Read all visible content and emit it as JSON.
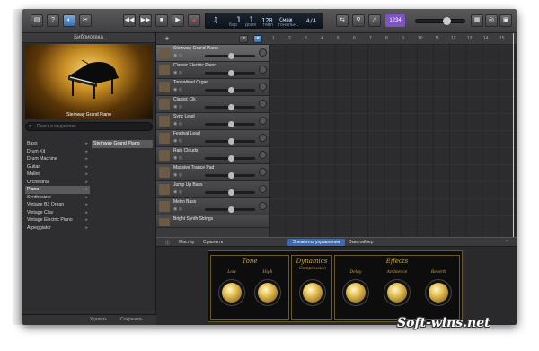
{
  "toolbar": {
    "lcd_bar": "1",
    "lcd_beat": "1",
    "lcd_bar_label": "бар",
    "lcd_beat_label": "доля",
    "tempo": "120",
    "tempo_label": "темп",
    "key": "Cмаж",
    "key_label": "тональн.",
    "time_sig": "4/4",
    "count_in": "1234"
  },
  "library": {
    "title": "Библиотека",
    "image_caption": "Steinway Grand Piano",
    "search_placeholder": "Поиск в медиатеке",
    "categories": [
      "Bass",
      "Drum Kit",
      "Drum Machine",
      "Guitar",
      "Mallet",
      "Orchestral",
      "Piano",
      "Synthesizer",
      "Vintage B3 Organ",
      "Vintage Clav",
      "Vintage Electric Piano",
      "Arpeggiator"
    ],
    "selected_category": "Piano",
    "presets": [
      "Steinway Grand Piano"
    ],
    "delete_label": "Удалить",
    "save_label": "Сохранить..."
  },
  "tracks": [
    {
      "name": "Steinway Grand Piano",
      "selected": true
    },
    {
      "name": "Classic Electric Piano"
    },
    {
      "name": "Tonewheel Organ"
    },
    {
      "name": "Classic Clk"
    },
    {
      "name": "Sync Lead"
    },
    {
      "name": "Festival Lead"
    },
    {
      "name": "Rain Clouds"
    },
    {
      "name": "Massive Trance Pad"
    },
    {
      "name": "Jump Up Bass"
    },
    {
      "name": "Metro Bass"
    },
    {
      "name": "Bright Synth Strings"
    }
  ],
  "ruler": [
    "1",
    "2",
    "3",
    "4",
    "5",
    "6",
    "7",
    "8",
    "9",
    "10",
    "11",
    "12",
    "13",
    "14",
    "15"
  ],
  "smart_controls": {
    "master": "Мастер",
    "compare": "Сравнить",
    "tab_controls": "Элементы управления",
    "tab_eq": "Эквалайзер",
    "sections": [
      {
        "title": "Tone",
        "knobs": [
          "Low",
          "High"
        ]
      },
      {
        "title": "Dynamics",
        "knobs": [
          "Compression"
        ]
      },
      {
        "title": "Effects",
        "knobs": [
          "Delay",
          "Ambience",
          "Reverb"
        ]
      }
    ]
  },
  "watermark": "Soft-wins.net"
}
